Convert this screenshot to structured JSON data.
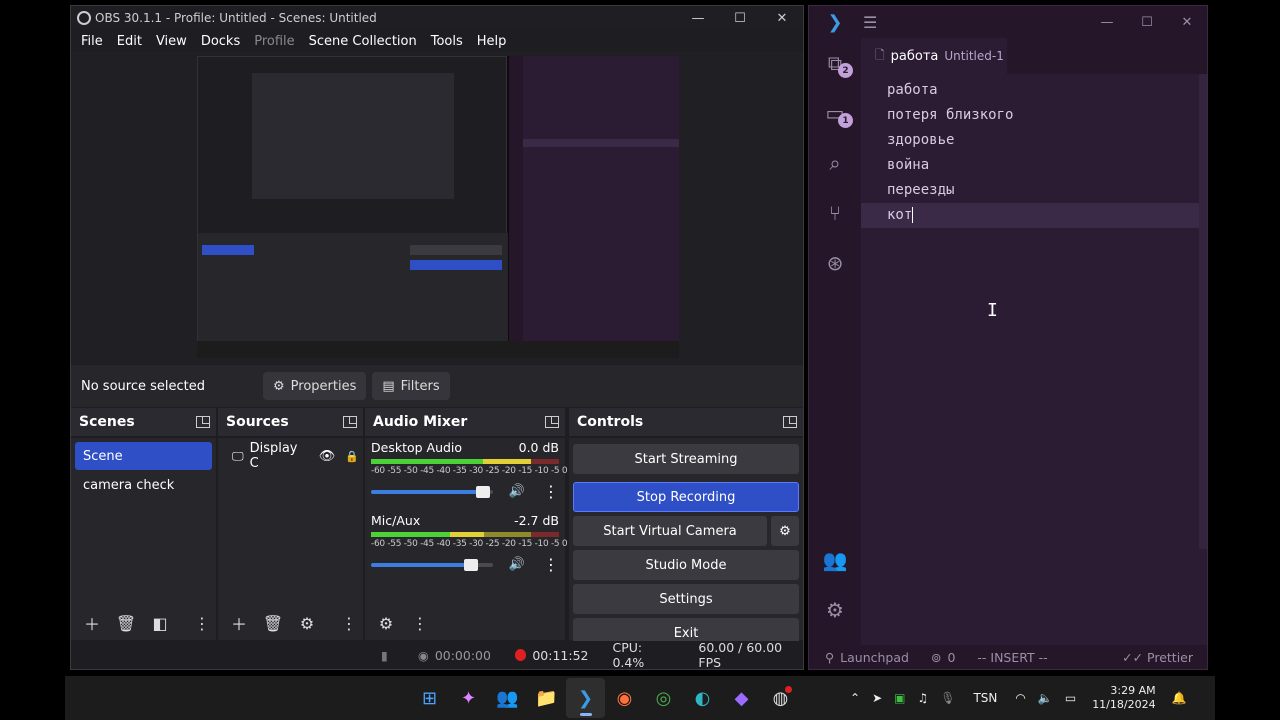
{
  "obs": {
    "title": "OBS 30.1.1 - Profile: Untitled - Scenes: Untitled",
    "menu": [
      "File",
      "Edit",
      "View",
      "Docks",
      "Profile",
      "Scene Collection",
      "Tools",
      "Help"
    ],
    "source_bar": {
      "no_source": "No source selected",
      "properties": "Properties",
      "filters": "Filters"
    },
    "scenes": {
      "title": "Scenes",
      "items": [
        "Scene",
        "camera check"
      ]
    },
    "sources": {
      "title": "Sources",
      "items": [
        "Display C"
      ]
    },
    "mixer": {
      "title": "Audio Mixer",
      "scale": "-60 -55 -50 -45 -40 -35 -30 -25 -20 -15 -10 -5 0",
      "channels": [
        {
          "name": "Desktop Audio",
          "db": "0.0 dB",
          "level": 0.85,
          "volume": 0.93
        },
        {
          "name": "Mic/Aux",
          "db": "-2.7 dB",
          "level": 0.6,
          "volume": 0.83
        }
      ]
    },
    "controls": {
      "title": "Controls",
      "start_streaming": "Start Streaming",
      "stop_recording": "Stop Recording",
      "start_virtual_camera": "Start Virtual Camera",
      "studio_mode": "Studio Mode",
      "settings": "Settings",
      "exit": "Exit"
    },
    "status": {
      "stream_time": "00:00:00",
      "rec_time": "00:11:52",
      "cpu": "CPU: 0.4%",
      "fps": "60.00 / 60.00 FPS"
    }
  },
  "vscode": {
    "tab_name": "работа",
    "tab_file": "Untitled-1",
    "badges": {
      "extensions": "2",
      "remote": "1"
    },
    "lines": [
      "работа",
      "потеря близкого",
      "здоровье",
      "война",
      "переезды",
      "кот"
    ],
    "status": {
      "launchpad": "Launchpad",
      "ports": "0",
      "mode": "-- INSERT --",
      "prettier": "Prettier"
    }
  },
  "taskbar": {
    "lang": "TSN",
    "time": "3:29 AM",
    "date": "11/18/2024"
  },
  "colors": {
    "obs_accent": "#2f4fc7",
    "vscode_bg": "#2b1b33",
    "rec_red": "#e02020"
  }
}
